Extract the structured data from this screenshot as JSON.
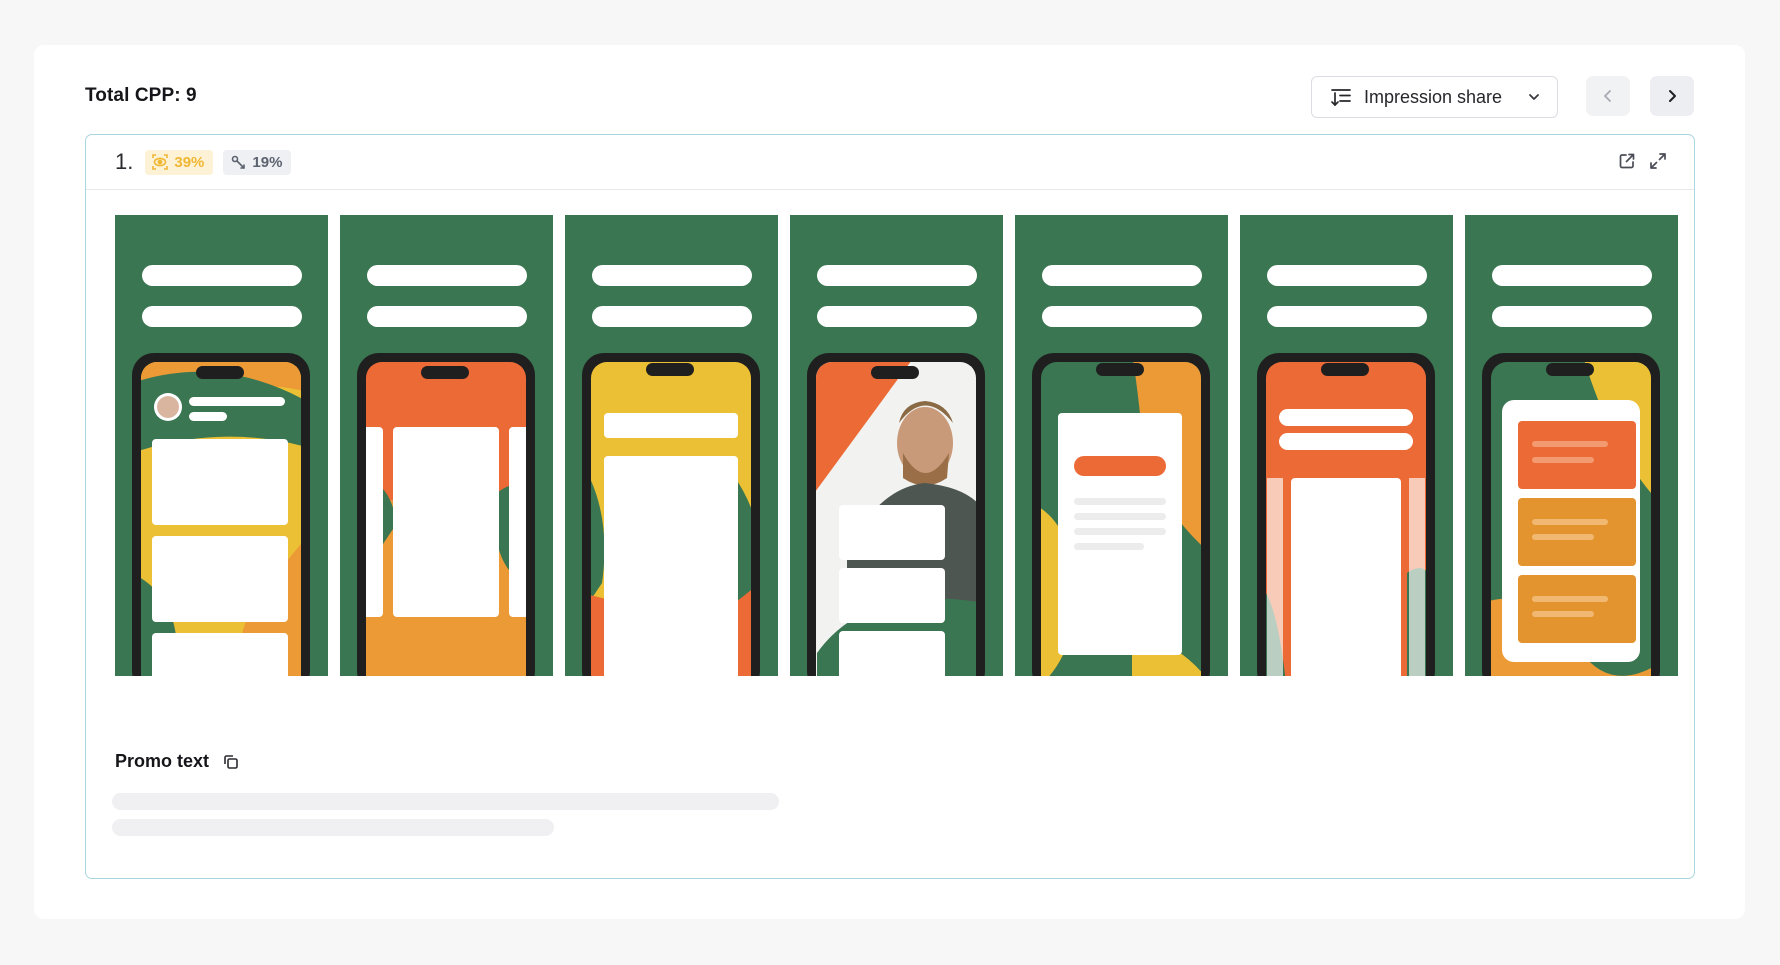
{
  "header": {
    "total_cpp": "Total CPP: 9",
    "sort_label": "Impression share"
  },
  "item": {
    "index": "1.",
    "impression_share": "39%",
    "conversion": "19%",
    "screenshot_count": 7
  },
  "promo": {
    "title": "Promo text"
  },
  "colors": {
    "accent_border": "#a9d6df",
    "screenshot_bg": "#397651",
    "impression_badge": "#f0b733",
    "orange": "#ec6a36",
    "yellow": "#ecc035",
    "amber": "#eb9a36"
  }
}
